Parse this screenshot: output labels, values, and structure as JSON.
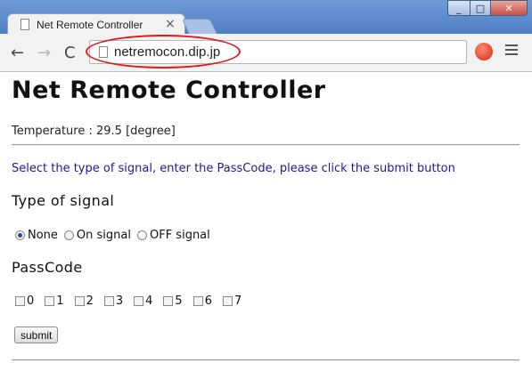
{
  "window": {
    "tab_title": "Net Remote Controller",
    "close_glyph": "×",
    "minimize_glyph": "_",
    "maximize_glyph": "□",
    "close_window_glyph": "✕"
  },
  "toolbar": {
    "back_glyph": "←",
    "forward_glyph": "→",
    "reload_glyph": "C",
    "url": "netremocon.dip.jp"
  },
  "page": {
    "title": "Net Remote Controller",
    "temperature": "Temperature : 29.5 [degree]",
    "instruction": "Select the type of signal, enter the PassCode, please click the submit button",
    "type_heading": "Type of signal",
    "signal_options": [
      {
        "label": "None",
        "checked": true
      },
      {
        "label": "On signal",
        "checked": false
      },
      {
        "label": "OFF signal",
        "checked": false
      }
    ],
    "passcode_heading": "PassCode",
    "passcode_bits": [
      "0",
      "1",
      "2",
      "3",
      "4",
      "5",
      "6",
      "7"
    ],
    "submit_label": "submit"
  },
  "colors": {
    "instruction_text": "#1a1a9a",
    "highlight": "#e01818"
  }
}
